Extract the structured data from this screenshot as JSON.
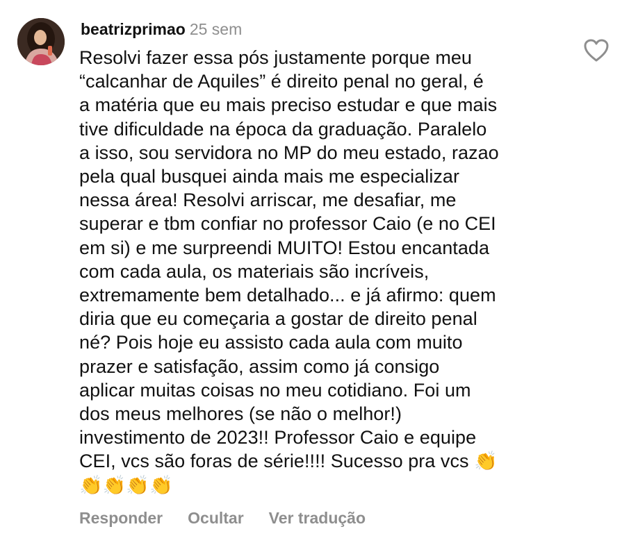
{
  "comment": {
    "username": "beatrizprimao",
    "timestamp": "25 sem",
    "lines": [
      "Resolvi fazer essa pós justamente porque meu",
      "“calcanhar de Aquiles” é direito penal no geral, é",
      "a matéria que eu mais preciso estudar e que mais",
      "tive dificuldade na época da graduação. Paralelo",
      "a isso, sou servidora no MP do meu estado, razao",
      "pela qual busquei ainda mais me especializar",
      "nessa área! Resolvi arriscar, me desafiar, me",
      "superar e tbm confiar no professor Caio (e no CEI",
      "em si) e me surpreendi MUITO! Estou encantada",
      "com cada aula, os materiais são incríveis,",
      "extremamente bem detalhado... e já afirmo: quem",
      "diria que eu começaria a gostar de direito penal",
      "né? Pois hoje eu assisto cada aula com muito",
      "prazer e satisfação, assim como já consigo",
      "aplicar muitas coisas no meu cotidiano. Foi um",
      "dos meus melhores (se não o melhor!)",
      "investimento de 2023!! Professor Caio e equipe",
      "CEI, vcs são foras de série!!!! Sucesso pra vcs 👏",
      "👏👏👏👏"
    ],
    "actions": {
      "reply": "Responder",
      "hide": "Ocultar",
      "translate": "Ver tradução"
    },
    "icons": {
      "like": "heart-icon",
      "avatar": "profile-avatar"
    },
    "colors": {
      "text": "#111111",
      "muted": "#8e8e8e",
      "background": "#ffffff"
    }
  }
}
